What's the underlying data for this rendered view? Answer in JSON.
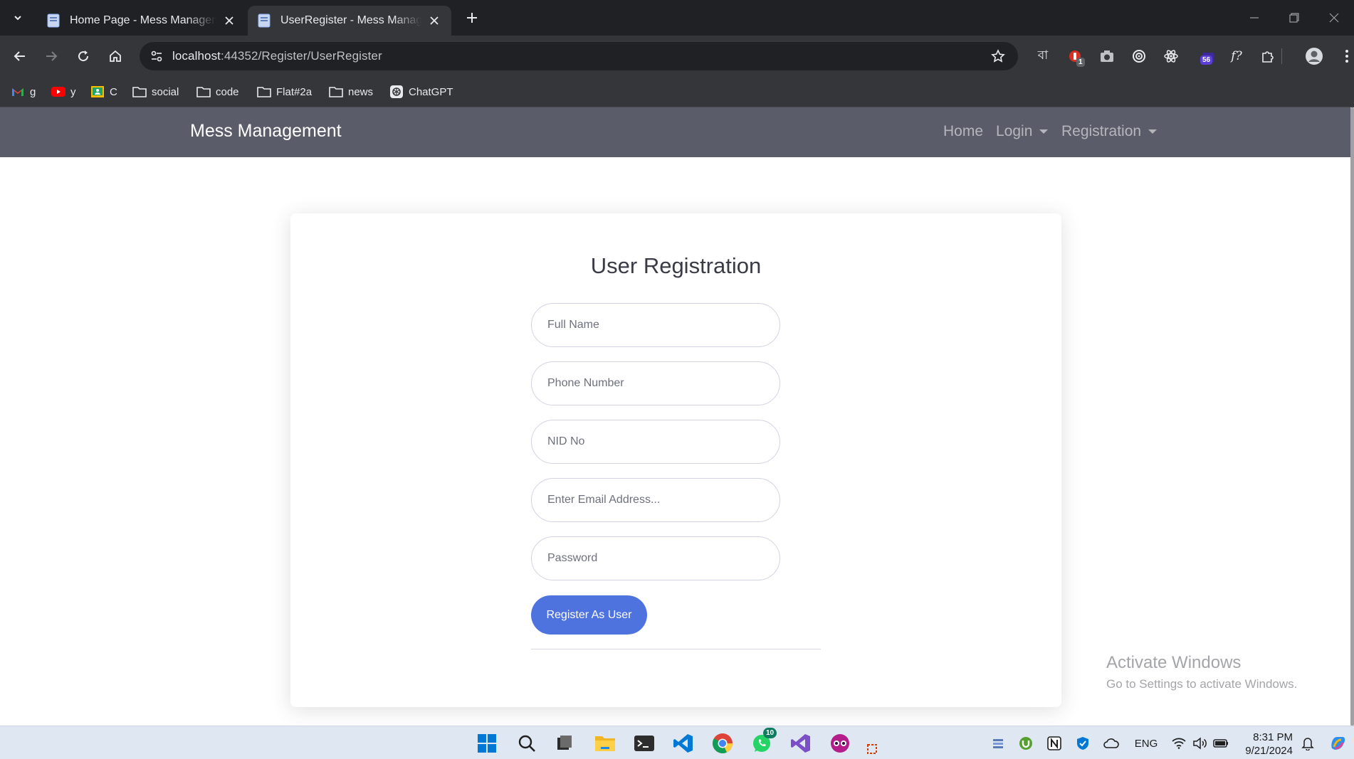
{
  "browser": {
    "tabs": [
      {
        "title": "Home Page - Mess Management",
        "active": false
      },
      {
        "title": "UserRegister - Mess Management",
        "active": true
      }
    ],
    "url_host": "localhost",
    "url_path": ":44352/Register/UserRegister",
    "extensions": {
      "bangla_label": "বা",
      "red_badge": "1",
      "purple_badge": "56",
      "font_label": "f?"
    },
    "bookmarks": [
      {
        "label": "g",
        "icon": "gmail-icon"
      },
      {
        "label": "y",
        "icon": "youtube-icon"
      },
      {
        "label": "C",
        "icon": "classroom-icon"
      },
      {
        "label": "social",
        "icon": "folder-icon"
      },
      {
        "label": "code",
        "icon": "folder-icon"
      },
      {
        "label": "Flat#2a",
        "icon": "folder-icon"
      },
      {
        "label": "news",
        "icon": "folder-icon"
      },
      {
        "label": "ChatGPT",
        "icon": "chatgpt-icon"
      }
    ]
  },
  "navbar": {
    "brand": "Mess Management",
    "links": {
      "home": "Home",
      "login": "Login",
      "registration": "Registration"
    }
  },
  "form": {
    "title": "User Registration",
    "full_name_placeholder": "Full Name",
    "phone_placeholder": "Phone Number",
    "nid_placeholder": "NID No",
    "email_placeholder": "Enter Email Address...",
    "password_placeholder": "Password",
    "submit_label": "Register As User"
  },
  "watermark": {
    "line1": "Activate Windows",
    "line2": "Go to Settings to activate Windows."
  },
  "taskbar": {
    "whatsapp_badge": "10",
    "language": "ENG",
    "time": "8:31 PM",
    "date": "9/21/2024"
  },
  "colors": {
    "navbar_bg": "#5a5c69",
    "primary_button": "#4e73df",
    "chrome_dark": "#202124",
    "chrome_toolbar": "#35363a"
  }
}
